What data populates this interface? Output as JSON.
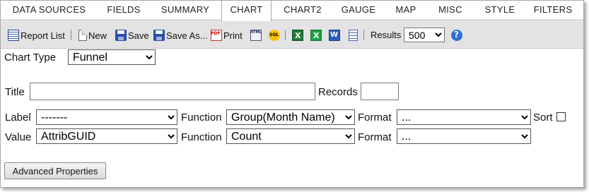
{
  "tabs": [
    "DATA SOURCES",
    "FIELDS",
    "SUMMARY",
    "CHART",
    "CHART2",
    "GAUGE",
    "MAP",
    "MISC",
    "STYLE",
    "FILTERS"
  ],
  "active_tab": "CHART",
  "toolbar": {
    "report_list": "Report List",
    "new": "New",
    "save": "Save",
    "save_as": "Save As...",
    "print": "Print",
    "results_label": "Results",
    "results_value": "500"
  },
  "form": {
    "chart_type_label": "Chart Type",
    "chart_type_value": "Funnel",
    "title_label": "Title",
    "title_value": "",
    "records_label": "Records",
    "records_value": "",
    "label_row": {
      "label": "Label",
      "value": "-------",
      "function_label": "Function",
      "function_value": "Group(Month Name)",
      "format_label": "Format",
      "format_value": "...",
      "sort_label": "Sort"
    },
    "value_row": {
      "label": "Value",
      "value": "AttribGUID",
      "function_label": "Function",
      "function_value": "Count",
      "format_label": "Format",
      "format_value": "..."
    },
    "advanced_button": "Advanced Properties"
  }
}
